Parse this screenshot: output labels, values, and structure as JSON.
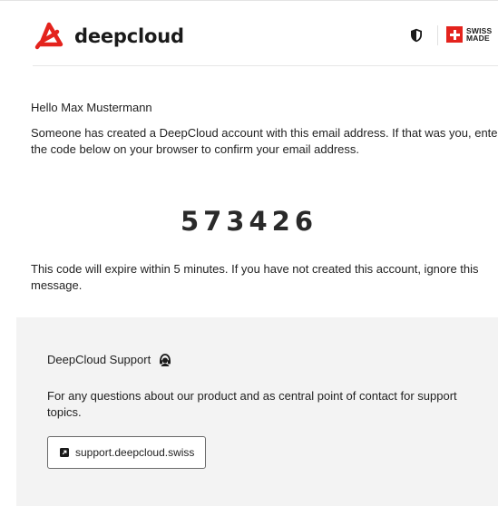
{
  "header": {
    "brand_name": "deepcloud",
    "swiss_badge_line1": "SWISS",
    "swiss_badge_line2": "MADE"
  },
  "email": {
    "greeting": "Hello Max Mustermann",
    "intro": "Someone has created a DeepCloud account with this email address. If that was you, enter the code below on your browser to confirm your email address.",
    "code": "573426",
    "expire_notice": "This code will expire within 5 minutes. If you have not created this account, ignore this message."
  },
  "support": {
    "title": "DeepCloud Support",
    "description": "For any questions about our product and as central point of contact for support topics.",
    "link_label": "support.deepcloud.swiss"
  },
  "colors": {
    "brand_red": "#e4231d",
    "support_bg": "#f3f3f3",
    "text": "#222222"
  },
  "icons": {
    "logo": "deepcloud-logo-icon",
    "privacy": "shield-icon",
    "flag": "swiss-flag-icon",
    "support": "headset-icon",
    "link": "external-link-icon"
  }
}
